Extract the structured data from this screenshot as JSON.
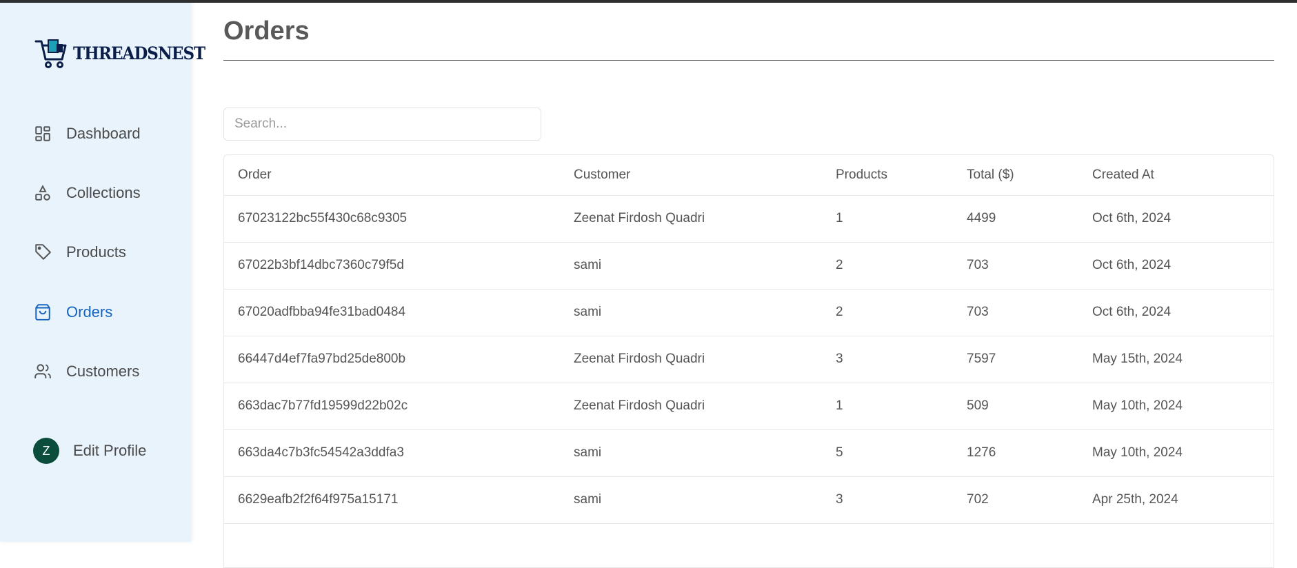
{
  "brand": {
    "name": "THREADSNEST"
  },
  "sidebar": {
    "items": [
      {
        "label": "Dashboard",
        "icon": "dashboard-icon"
      },
      {
        "label": "Collections",
        "icon": "shapes-icon"
      },
      {
        "label": "Products",
        "icon": "tag-icon"
      },
      {
        "label": "Orders",
        "icon": "shopping-bag-icon",
        "active": true
      },
      {
        "label": "Customers",
        "icon": "users-icon"
      }
    ],
    "profile": {
      "initial": "Z",
      "label": "Edit Profile"
    }
  },
  "page": {
    "title": "Orders"
  },
  "search": {
    "placeholder": "Search..."
  },
  "table": {
    "headers": [
      "Order",
      "Customer",
      "Products",
      "Total ($)",
      "Created At"
    ],
    "rows": [
      [
        "67023122bc55f430c68c9305",
        "Zeenat Firdosh Quadri",
        "1",
        "4499",
        "Oct 6th, 2024"
      ],
      [
        "67022b3bf14dbc7360c79f5d",
        "sami",
        "2",
        "703",
        "Oct 6th, 2024"
      ],
      [
        "67020adfbba94fe31bad0484",
        "sami",
        "2",
        "703",
        "Oct 6th, 2024"
      ],
      [
        "66447d4ef7fa97bd25de800b",
        "Zeenat Firdosh Quadri",
        "3",
        "7597",
        "May 15th, 2024"
      ],
      [
        "663dac7b77fd19599d22b02c",
        "Zeenat Firdosh Quadri",
        "1",
        "509",
        "May 10th, 2024"
      ],
      [
        "663da4c7b3fc54542a3ddfa3",
        "sami",
        "5",
        "1276",
        "May 10th, 2024"
      ],
      [
        "6629eafb2f2f64f975a15171",
        "sami",
        "3",
        "702",
        "Apr 25th, 2024"
      ]
    ]
  },
  "colors": {
    "sidebar_bg": "#e8f3fc",
    "accent": "#1565c0",
    "avatar_bg": "#0b4d3c"
  }
}
